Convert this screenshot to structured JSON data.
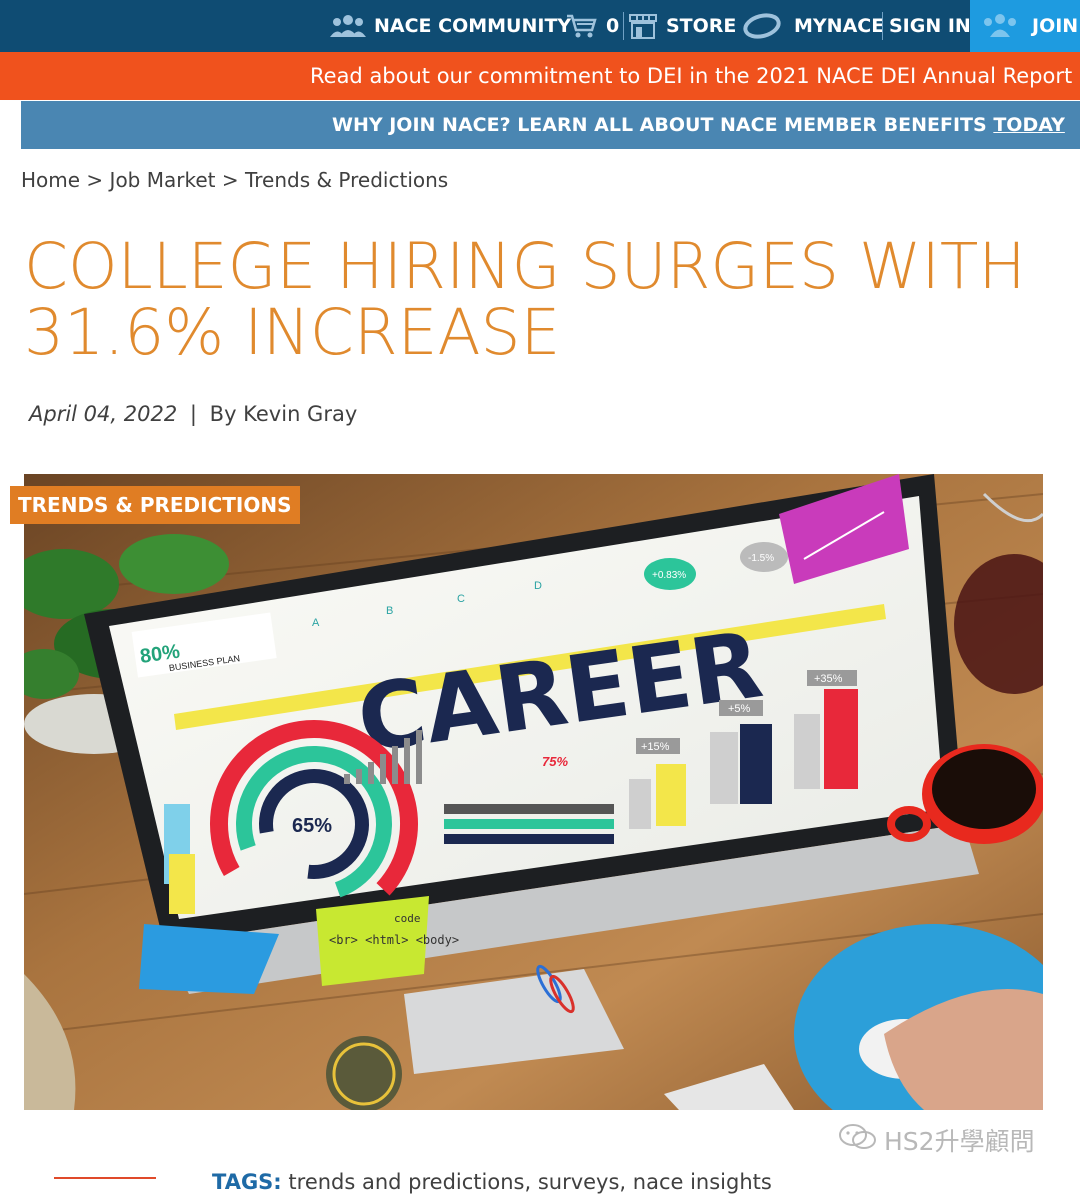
{
  "topbar": {
    "community_label": "NACE COMMUNITY",
    "cart_count": "0",
    "store_label": "STORE",
    "mynace_label": "MYNACE",
    "signin_label": "SIGN IN",
    "join_label": "JOIN",
    "icons": [
      "people-icon",
      "cart-icon",
      "store-icon",
      "mynace-logo-icon"
    ]
  },
  "banner": {
    "dei_link": "Read about our commitment to DEI in the 2021 NACE DEI Annual Report",
    "benefits_text": "WHY JOIN NACE? LEARN ALL ABOUT NACE MEMBER BENEFITS ",
    "benefits_link": "TODAY"
  },
  "breadcrumb": {
    "items": [
      "Home",
      "Job Market",
      "Trends & Predictions"
    ],
    "separator": ">"
  },
  "article": {
    "title_line1": "COLLEGE HIRING SURGES WITH",
    "title_line2": "31.6% INCREASE",
    "date": "April 04, 2022",
    "divider": "|",
    "author": "By Kevin Gray",
    "category_badge": "TRENDS & PREDICTIONS"
  },
  "hero_image": {
    "screen_word": "CAREER",
    "business_plan_pct": "80%",
    "business_plan_label": "BUSINESS PLAN",
    "donut_pct": "65%",
    "people_pct": "75%",
    "bar_labels": [
      "+15%",
      "+5%",
      "+35%"
    ],
    "bubbles": [
      "+0.83%",
      "-1.5%"
    ],
    "abcd": [
      "A",
      "B",
      "C",
      "D"
    ],
    "note_text": "<br> <html> <body>",
    "note_code": "code"
  },
  "watermark": "HS2升學顧問",
  "tags": {
    "label": "TAGS:",
    "values": "trends and predictions, surveys, nace insights"
  },
  "colors": {
    "topbar": "#0f4c73",
    "join": "#1e9be0",
    "orange_bar": "#f0521d",
    "blue_bar": "#4a86b2",
    "title": "#e08a2e",
    "badge": "#e07d23"
  }
}
